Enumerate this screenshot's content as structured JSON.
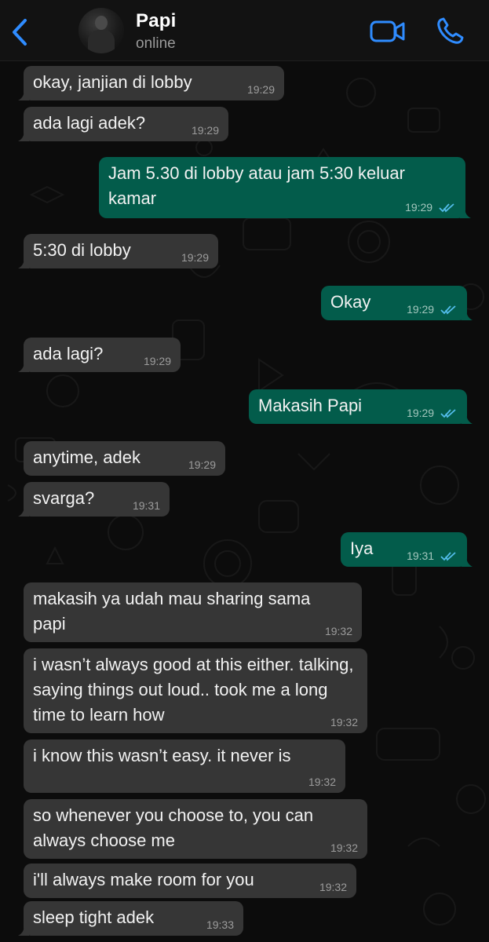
{
  "header": {
    "back_icon": "chevron-left-icon",
    "contact_name": "Papi",
    "status": "online",
    "video_icon": "video-call-icon",
    "phone_icon": "phone-icon",
    "accent_color": "#2f8cff"
  },
  "messages": [
    {
      "dir": "in",
      "text": "okay, janjian di lobby",
      "time": "19:29"
    },
    {
      "dir": "in",
      "text": "ada lagi adek?",
      "time": "19:29"
    },
    {
      "dir": "out",
      "text": "Jam 5.30 di lobby atau jam 5:30 keluar kamar",
      "time": "19:29",
      "read": true
    },
    {
      "dir": "in",
      "text": "5:30 di lobby",
      "time": "19:29"
    },
    {
      "dir": "out",
      "text": "Okay",
      "time": "19:29",
      "read": true
    },
    {
      "dir": "in",
      "text": "ada lagi?",
      "time": "19:29"
    },
    {
      "dir": "out",
      "text": "Makasih Papi",
      "time": "19:29",
      "read": true
    },
    {
      "dir": "in",
      "text": "anytime, adek",
      "time": "19:29"
    },
    {
      "dir": "in",
      "text": "svarga?",
      "time": "19:31"
    },
    {
      "dir": "out",
      "text": "Iya",
      "time": "19:31",
      "read": true
    },
    {
      "dir": "in",
      "text": "makasih ya udah mau sharing sama papi",
      "time": "19:32"
    },
    {
      "dir": "in",
      "text": "i wasn’t always good at this either. talking, saying things out loud.. took me a long time to learn how",
      "time": "19:32"
    },
    {
      "dir": "in",
      "text": "i know this wasn’t easy. it never is",
      "time": "19:32"
    },
    {
      "dir": "in",
      "text": "so whenever you choose to, you can always choose me",
      "time": "19:32"
    },
    {
      "dir": "in",
      "text": "i'll always make room for you",
      "time": "19:32"
    },
    {
      "dir": "in",
      "text": "sleep tight adek",
      "time": "19:33"
    }
  ],
  "colors": {
    "incoming_bubble": "#363636",
    "outgoing_bubble": "#035c4b",
    "read_ticks": "#53bdeb"
  }
}
